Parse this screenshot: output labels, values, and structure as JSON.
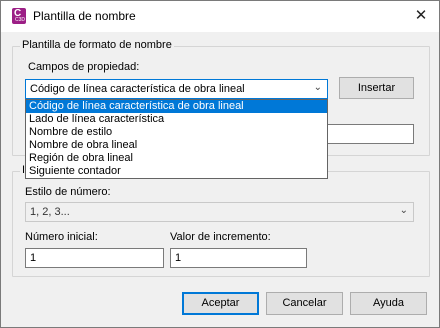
{
  "window": {
    "title": "Plantilla de nombre",
    "app_icon": "civil3d-app-icon",
    "close_glyph": "✕"
  },
  "template_group": {
    "label": "Plantilla de formato de nombre",
    "property_fields_label": "Campos de propiedad:",
    "property_fields_value": "Código de línea característica de obra lineal",
    "insert_button": "Insertar",
    "format_string_value": "",
    "dropdown_options": [
      "Código de línea característica de obra lineal",
      "Lado de línea característica",
      "Nombre de estilo",
      "Nombre de obra lineal",
      "Región de obra lineal",
      "Siguiente contador"
    ],
    "dropdown_selected_index": 0
  },
  "numbering_group": {
    "label_fragment": "I",
    "number_style_label": "Estilo de número:",
    "number_style_value": "1, 2, 3...",
    "start_number_label": "Número inicial:",
    "start_number_value": "1",
    "increment_label": "Valor de incremento:",
    "increment_value": "1"
  },
  "buttons": {
    "ok": "Aceptar",
    "cancel": "Cancelar",
    "help": "Ayuda"
  }
}
